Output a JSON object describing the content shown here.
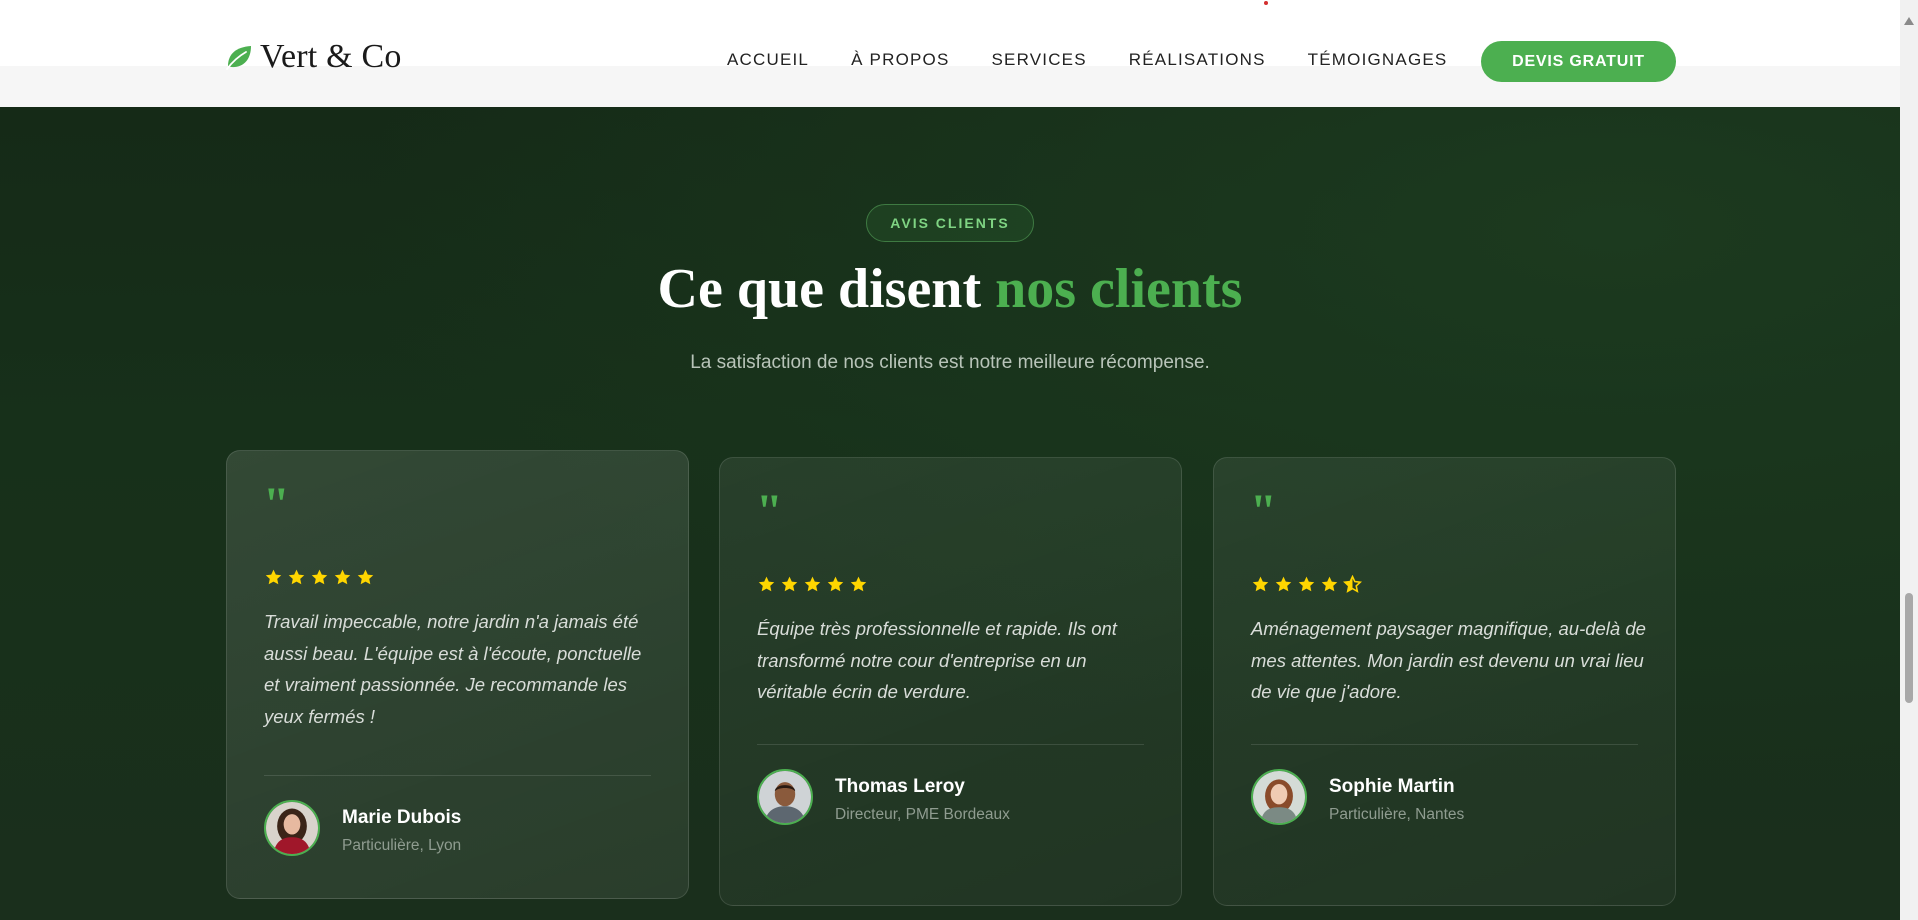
{
  "header": {
    "logo_text": "Vert & Co",
    "nav": [
      "ACCUEIL",
      "À PROPOS",
      "SERVICES",
      "RÉALISATIONS",
      "TÉMOIGNAGES"
    ],
    "cta_label": "DEVIS GRATUIT"
  },
  "section": {
    "badge": "AVIS CLIENTS",
    "title_main": "Ce que disent ",
    "title_accent": "nos clients",
    "subtitle": "La satisfaction de nos clients est notre meilleure récompense."
  },
  "testimonials": [
    {
      "quote_mark": "\"",
      "rating": 5,
      "text": "Travail impeccable, notre jardin n'a jamais été aussi beau. L'équipe est à l'écoute, ponctuelle et vraiment passionnée. Je recommande les yeux fermés !",
      "name": "Marie Dubois",
      "role": "Particulière, Lyon"
    },
    {
      "quote_mark": "\"",
      "rating": 5,
      "text": "Équipe très professionnelle et rapide. Ils ont transformé notre cour d'entreprise en un véritable écrin de verdure.",
      "name": "Thomas Leroy",
      "role": "Directeur, PME Bordeaux"
    },
    {
      "quote_mark": "\"",
      "rating": 4.5,
      "text": "Aménagement paysager magnifique, au-delà de mes attentes. Mon jardin est devenu un vrai lieu de vie que j'adore.",
      "name": "Sophie Martin",
      "role": "Particulière, Nantes"
    }
  ],
  "colors": {
    "accent": "#4caf50",
    "star": "#ffd600",
    "section_bg": "#17301a"
  },
  "icons": {
    "logo": "leaf-icon",
    "rating": "star-icon"
  }
}
